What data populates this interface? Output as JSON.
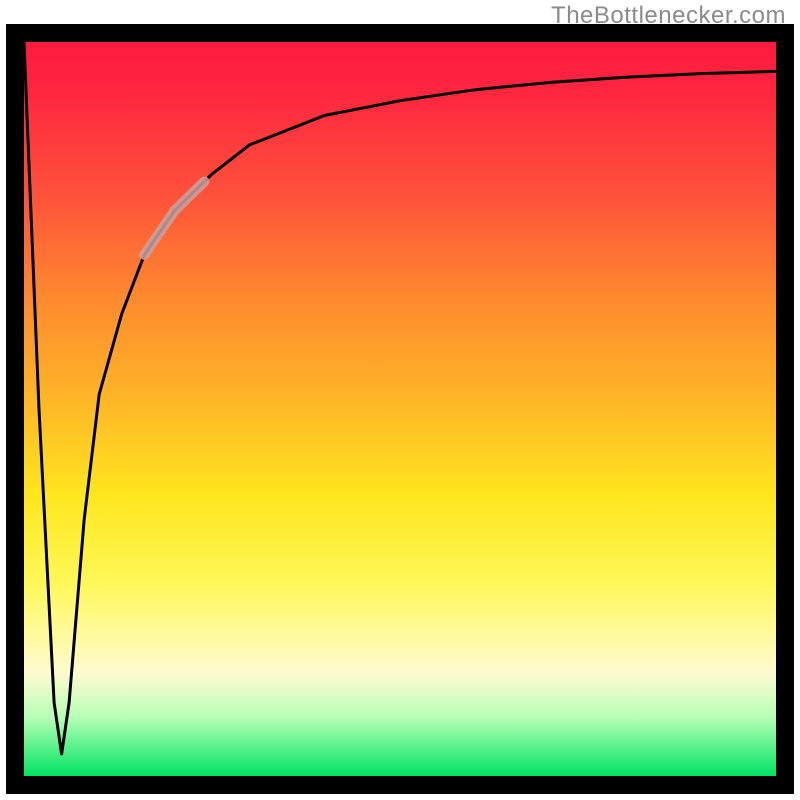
{
  "attribution": "TheBottlenecker.com",
  "chart_data": {
    "type": "line",
    "title": "",
    "xlabel": "",
    "ylabel": "",
    "xlim": [
      0,
      100
    ],
    "ylim": [
      0,
      100
    ],
    "grid": false,
    "legend": false,
    "background_gradient": {
      "direction": "vertical",
      "stops": [
        {
          "pos": 0.0,
          "color": "#ff1a3e"
        },
        {
          "pos": 0.35,
          "color": "#ff8a2e"
        },
        {
          "pos": 0.62,
          "color": "#ffe71e"
        },
        {
          "pos": 0.86,
          "color": "#fffbd0"
        },
        {
          "pos": 1.0,
          "color": "#00e463"
        }
      ]
    },
    "series": [
      {
        "name": "bottleneck-curve",
        "color": "#000000",
        "width": 3,
        "x": [
          0,
          2,
          4,
          5,
          6,
          8,
          10,
          13,
          16,
          20,
          25,
          30,
          35,
          40,
          50,
          60,
          70,
          80,
          90,
          100
        ],
        "y": [
          100,
          50,
          10,
          3,
          10,
          35,
          52,
          63,
          71,
          77,
          82,
          86,
          88,
          90,
          92,
          93.5,
          94.5,
          95.2,
          95.7,
          96
        ]
      },
      {
        "name": "highlight-segment",
        "color": "#caa2a2",
        "width": 10,
        "opacity": 0.85,
        "x": [
          16,
          18,
          20,
          22,
          24
        ],
        "y": [
          71,
          74,
          77,
          79,
          81
        ]
      }
    ],
    "note": "Axis values are relative (0-100) estimates read from the unlabeled plot. The curve drops sharply from y≈100 at x≈0 to a minimum y≈3 near x≈5, then rises asymptotically toward y≈96 at x=100. A short pale segment overlays the curve around x≈16–24."
  }
}
